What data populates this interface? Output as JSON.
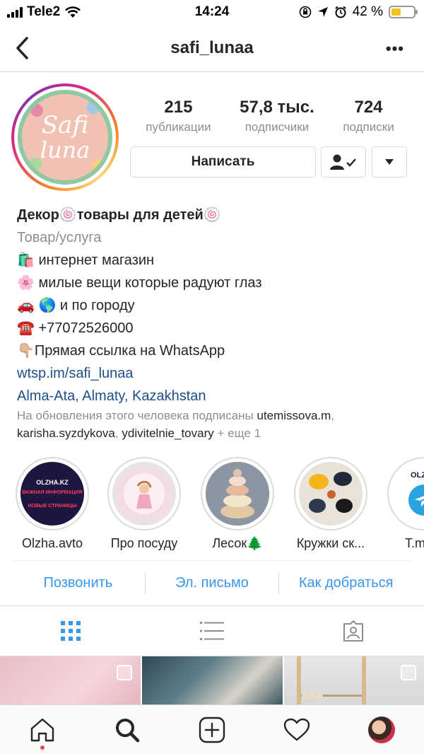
{
  "status_bar": {
    "carrier": "Tele2",
    "time": "14:24",
    "battery_percent": "42 %"
  },
  "nav": {
    "username": "safi_lunaa"
  },
  "avatar": {
    "logo_line1": "Safi",
    "logo_line2": "luna"
  },
  "stats": [
    {
      "value": "215",
      "label": "публикации"
    },
    {
      "value": "57,8 тыс.",
      "label": "подписчики"
    },
    {
      "value": "724",
      "label": "подписки"
    }
  ],
  "actions": {
    "message_label": "Написать"
  },
  "bio": {
    "name": "Декор🍥товары для детей🍥",
    "category": "Товар/услуга",
    "lines": [
      "🛍️ интернет магазин",
      "🌸 милые вещи которые радуют глаз",
      "🚗 🌎 и по городу",
      "☎️ +77072526000",
      "👇🏼Прямая ссылка на WhatsApp"
    ],
    "website": "wtsp.im/safi_lunaa",
    "location": "Alma-Ata, Almaty, Kazakhstan"
  },
  "followed_by": {
    "prefix": "На обновления этого человека подписаны",
    "user1": "utemissova.m",
    "user2": "karisha.syzdykova",
    "user3": "ydivitelnie_tovary",
    "suffix": "+ еще 1"
  },
  "highlights": [
    {
      "caption": "Olzha.avto",
      "text_top": "OLZHA.KZ",
      "text_mid": "ВАЖНАЯ ИНФОРМАЦИЯ",
      "text_bottom": "НОВЫЕ СТРАНИЦЫ"
    },
    {
      "caption": "Про посуду"
    },
    {
      "caption": "Лесок🌲"
    },
    {
      "caption": "Кружки ск..."
    },
    {
      "caption": "T.me/o",
      "text_top": "OLZHA"
    }
  ],
  "contacts": {
    "call": "Позвонить",
    "email": "Эл. письмо",
    "directions": "Как добраться"
  },
  "colors": {
    "link_blue": "#3897f0",
    "text": "#262626",
    "muted": "#8e8e8e",
    "border": "#dbdbdb",
    "notification_dot": "#ed4956"
  }
}
